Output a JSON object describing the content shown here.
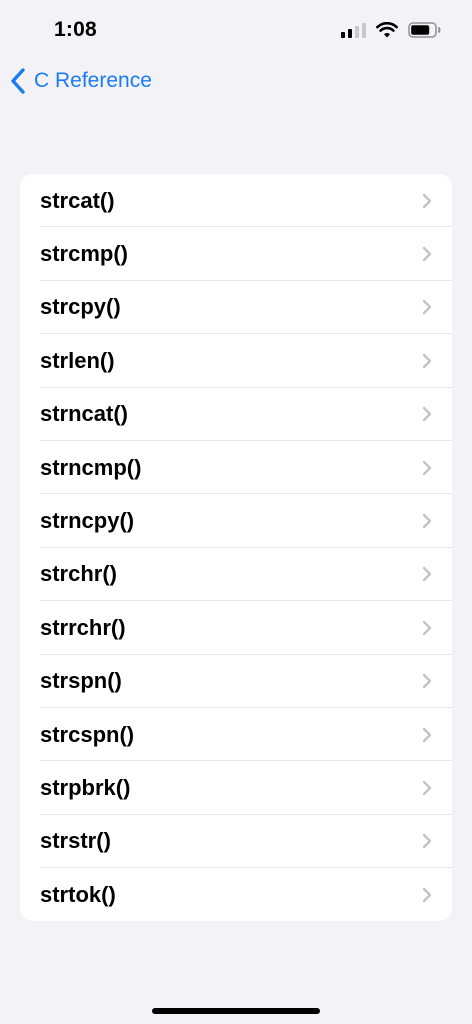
{
  "status_bar": {
    "time": "1:08"
  },
  "nav": {
    "back_label": "C Reference"
  },
  "list": {
    "items": [
      {
        "label": "strcat()"
      },
      {
        "label": "strcmp()"
      },
      {
        "label": "strcpy()"
      },
      {
        "label": "strlen()"
      },
      {
        "label": "strncat()"
      },
      {
        "label": "strncmp()"
      },
      {
        "label": "strncpy()"
      },
      {
        "label": "strchr()"
      },
      {
        "label": "strrchr()"
      },
      {
        "label": "strspn()"
      },
      {
        "label": "strcspn()"
      },
      {
        "label": "strpbrk()"
      },
      {
        "label": "strstr()"
      },
      {
        "label": "strtok()"
      }
    ]
  },
  "colors": {
    "accent": "#1a7cf0",
    "background": "#f2f2f7",
    "separator": "#e5e5ea",
    "chevron": "#c4c4c7"
  }
}
